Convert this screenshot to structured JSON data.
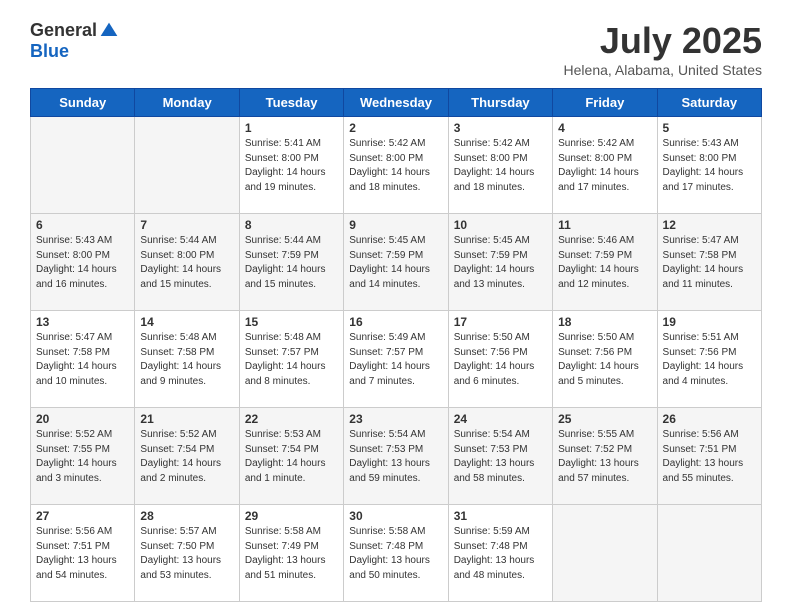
{
  "header": {
    "logo_general": "General",
    "logo_blue": "Blue",
    "main_title": "July 2025",
    "subtitle": "Helena, Alabama, United States"
  },
  "days_of_week": [
    "Sunday",
    "Monday",
    "Tuesday",
    "Wednesday",
    "Thursday",
    "Friday",
    "Saturday"
  ],
  "weeks": [
    {
      "bg": "white",
      "cells": [
        {
          "day": "",
          "info": ""
        },
        {
          "day": "",
          "info": ""
        },
        {
          "day": "1",
          "info": "Sunrise: 5:41 AM\nSunset: 8:00 PM\nDaylight: 14 hours\nand 19 minutes."
        },
        {
          "day": "2",
          "info": "Sunrise: 5:42 AM\nSunset: 8:00 PM\nDaylight: 14 hours\nand 18 minutes."
        },
        {
          "day": "3",
          "info": "Sunrise: 5:42 AM\nSunset: 8:00 PM\nDaylight: 14 hours\nand 18 minutes."
        },
        {
          "day": "4",
          "info": "Sunrise: 5:42 AM\nSunset: 8:00 PM\nDaylight: 14 hours\nand 17 minutes."
        },
        {
          "day": "5",
          "info": "Sunrise: 5:43 AM\nSunset: 8:00 PM\nDaylight: 14 hours\nand 17 minutes."
        }
      ]
    },
    {
      "bg": "gray",
      "cells": [
        {
          "day": "6",
          "info": "Sunrise: 5:43 AM\nSunset: 8:00 PM\nDaylight: 14 hours\nand 16 minutes."
        },
        {
          "day": "7",
          "info": "Sunrise: 5:44 AM\nSunset: 8:00 PM\nDaylight: 14 hours\nand 15 minutes."
        },
        {
          "day": "8",
          "info": "Sunrise: 5:44 AM\nSunset: 7:59 PM\nDaylight: 14 hours\nand 15 minutes."
        },
        {
          "day": "9",
          "info": "Sunrise: 5:45 AM\nSunset: 7:59 PM\nDaylight: 14 hours\nand 14 minutes."
        },
        {
          "day": "10",
          "info": "Sunrise: 5:45 AM\nSunset: 7:59 PM\nDaylight: 14 hours\nand 13 minutes."
        },
        {
          "day": "11",
          "info": "Sunrise: 5:46 AM\nSunset: 7:59 PM\nDaylight: 14 hours\nand 12 minutes."
        },
        {
          "day": "12",
          "info": "Sunrise: 5:47 AM\nSunset: 7:58 PM\nDaylight: 14 hours\nand 11 minutes."
        }
      ]
    },
    {
      "bg": "white",
      "cells": [
        {
          "day": "13",
          "info": "Sunrise: 5:47 AM\nSunset: 7:58 PM\nDaylight: 14 hours\nand 10 minutes."
        },
        {
          "day": "14",
          "info": "Sunrise: 5:48 AM\nSunset: 7:58 PM\nDaylight: 14 hours\nand 9 minutes."
        },
        {
          "day": "15",
          "info": "Sunrise: 5:48 AM\nSunset: 7:57 PM\nDaylight: 14 hours\nand 8 minutes."
        },
        {
          "day": "16",
          "info": "Sunrise: 5:49 AM\nSunset: 7:57 PM\nDaylight: 14 hours\nand 7 minutes."
        },
        {
          "day": "17",
          "info": "Sunrise: 5:50 AM\nSunset: 7:56 PM\nDaylight: 14 hours\nand 6 minutes."
        },
        {
          "day": "18",
          "info": "Sunrise: 5:50 AM\nSunset: 7:56 PM\nDaylight: 14 hours\nand 5 minutes."
        },
        {
          "day": "19",
          "info": "Sunrise: 5:51 AM\nSunset: 7:56 PM\nDaylight: 14 hours\nand 4 minutes."
        }
      ]
    },
    {
      "bg": "gray",
      "cells": [
        {
          "day": "20",
          "info": "Sunrise: 5:52 AM\nSunset: 7:55 PM\nDaylight: 14 hours\nand 3 minutes."
        },
        {
          "day": "21",
          "info": "Sunrise: 5:52 AM\nSunset: 7:54 PM\nDaylight: 14 hours\nand 2 minutes."
        },
        {
          "day": "22",
          "info": "Sunrise: 5:53 AM\nSunset: 7:54 PM\nDaylight: 14 hours\nand 1 minute."
        },
        {
          "day": "23",
          "info": "Sunrise: 5:54 AM\nSunset: 7:53 PM\nDaylight: 13 hours\nand 59 minutes."
        },
        {
          "day": "24",
          "info": "Sunrise: 5:54 AM\nSunset: 7:53 PM\nDaylight: 13 hours\nand 58 minutes."
        },
        {
          "day": "25",
          "info": "Sunrise: 5:55 AM\nSunset: 7:52 PM\nDaylight: 13 hours\nand 57 minutes."
        },
        {
          "day": "26",
          "info": "Sunrise: 5:56 AM\nSunset: 7:51 PM\nDaylight: 13 hours\nand 55 minutes."
        }
      ]
    },
    {
      "bg": "white",
      "cells": [
        {
          "day": "27",
          "info": "Sunrise: 5:56 AM\nSunset: 7:51 PM\nDaylight: 13 hours\nand 54 minutes."
        },
        {
          "day": "28",
          "info": "Sunrise: 5:57 AM\nSunset: 7:50 PM\nDaylight: 13 hours\nand 53 minutes."
        },
        {
          "day": "29",
          "info": "Sunrise: 5:58 AM\nSunset: 7:49 PM\nDaylight: 13 hours\nand 51 minutes."
        },
        {
          "day": "30",
          "info": "Sunrise: 5:58 AM\nSunset: 7:48 PM\nDaylight: 13 hours\nand 50 minutes."
        },
        {
          "day": "31",
          "info": "Sunrise: 5:59 AM\nSunset: 7:48 PM\nDaylight: 13 hours\nand 48 minutes."
        },
        {
          "day": "",
          "info": ""
        },
        {
          "day": "",
          "info": ""
        }
      ]
    }
  ]
}
